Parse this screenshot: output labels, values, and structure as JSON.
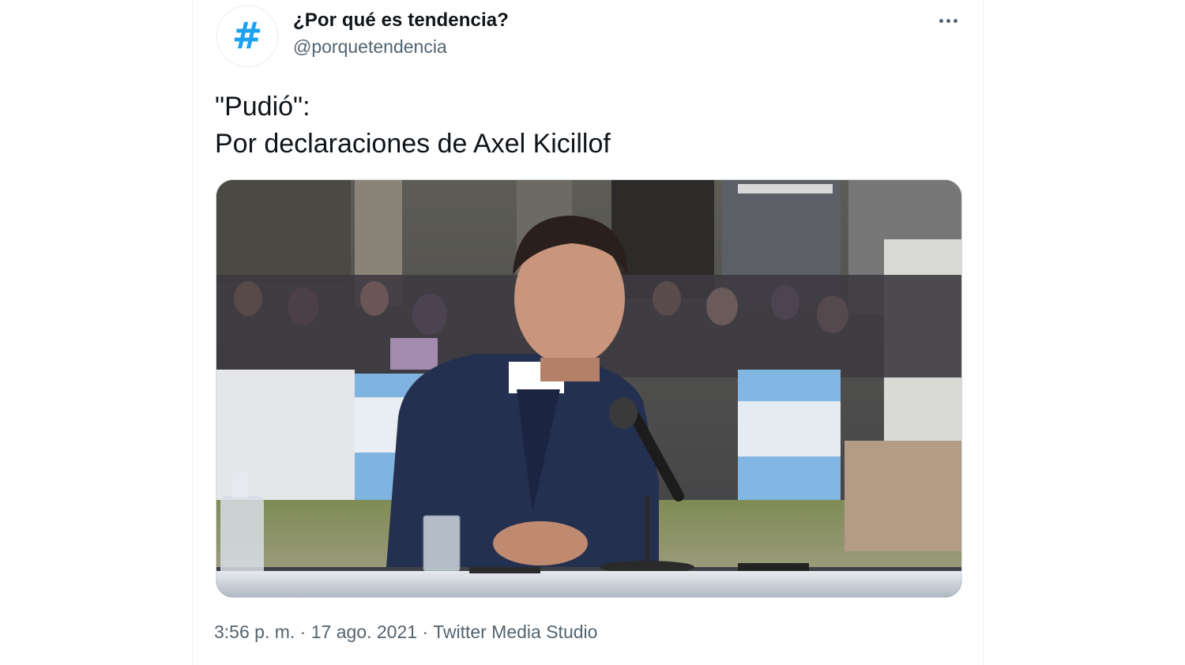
{
  "account": {
    "display_name": "¿Por qué es tendencia?",
    "handle": "@porquetendencia",
    "avatar_icon": "hashtag-icon",
    "avatar_glyph": "#",
    "avatar_color": "#1da1f2"
  },
  "tweet": {
    "text": "\"Pudió\":\nPor declaraciones de Axel Kicillof",
    "media_icon": "video-thumbnail"
  },
  "meta": {
    "time": "3:56 p. m.",
    "separator": " · ",
    "date": "17 ago. 2021",
    "source": "Twitter Media Studio"
  },
  "menu": {
    "icon": "more-horizontal-icon"
  }
}
